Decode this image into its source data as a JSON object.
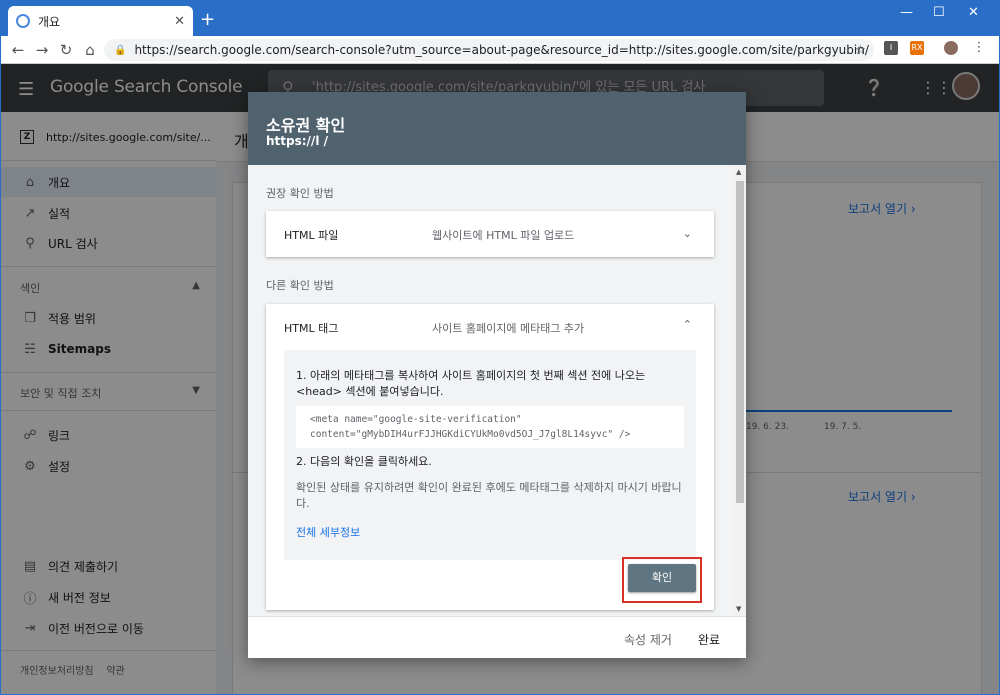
{
  "browser": {
    "tab_title": "개요",
    "tab_close": "✕",
    "new_tab": "+",
    "url": "https://search.google.com/search-console?utm_source=about-page&resource_id=http://sites.google.com/site/parkgyubin/",
    "ext_rx": "RX"
  },
  "app": {
    "logo": "Google Search Console",
    "search_placeholder": "'http://sites.google.com/site/parkgyubin/'에 있는 모든 URL 검사"
  },
  "sidebar": {
    "property": "http://sites.google.com/site/...",
    "items": [
      {
        "label": "개요",
        "icon": "home-icon"
      },
      {
        "label": "실적",
        "icon": "trending-icon"
      },
      {
        "label": "URL 검사",
        "icon": "search-icon"
      },
      {
        "label": "적용 범위",
        "icon": "copy-icon"
      },
      {
        "label": "Sitemaps",
        "icon": "sitemap-icon"
      },
      {
        "label": "링크",
        "icon": "links-icon"
      },
      {
        "label": "설정",
        "icon": "gear-icon"
      },
      {
        "label": "의견 제출하기",
        "icon": "feedback-icon"
      },
      {
        "label": "새 버전 정보",
        "icon": "info-icon"
      },
      {
        "label": "이전 버전으로 이동",
        "icon": "exit-icon"
      }
    ],
    "section_index": "색인",
    "section_security": "보안 및 직접 조치",
    "footer_privacy": "개인정보처리방침",
    "footer_terms": "약관"
  },
  "main": {
    "page_title": "개",
    "report_link": "보고서 열기",
    "x_ticks": [
      "19. 6. 23.",
      "19. 7. 5."
    ]
  },
  "dialog": {
    "title": "소유권 확인",
    "url": "https://l           /",
    "recommended_label": "권장 확인 방법",
    "other_label": "다른 확인 방법",
    "html_file": {
      "name": "HTML 파일",
      "desc": "웹사이트에 HTML 파일 업로드"
    },
    "html_tag": {
      "name": "HTML 태그",
      "desc": "사이트 홈페이지에 메타태그 추가"
    },
    "step1": "1. 아래의 메타태그를 복사하여 사이트 홈페이지의 첫 번째 섹션 전에 나오는 <head> 섹션에 붙여넣습니다.",
    "code_line1": "<meta name=\"google-site-verification\"",
    "code_line2": "content=\"gMybDIH4urFJJHGKdiCYUkMo0vd5OJ_J7gl8L14syvc\" />",
    "step2": "2. 다음의 확인을 클릭하세요.",
    "hint": "확인된 상태를 유지하려면 확인이 완료된 후에도 메타태그를 삭제하지 마시기 바랍니다.",
    "details_link": "전체 세부정보",
    "verify_button": "확인",
    "remove_property": "속성 제거",
    "done_button": "완료"
  },
  "colors": {
    "titlebar": "#2a6fc7",
    "appbar": "#3c4043",
    "dialog_header": "#4f626d",
    "verify_button": "#5f7682",
    "highlight_box": "#d93025",
    "link": "#1a73e8"
  }
}
